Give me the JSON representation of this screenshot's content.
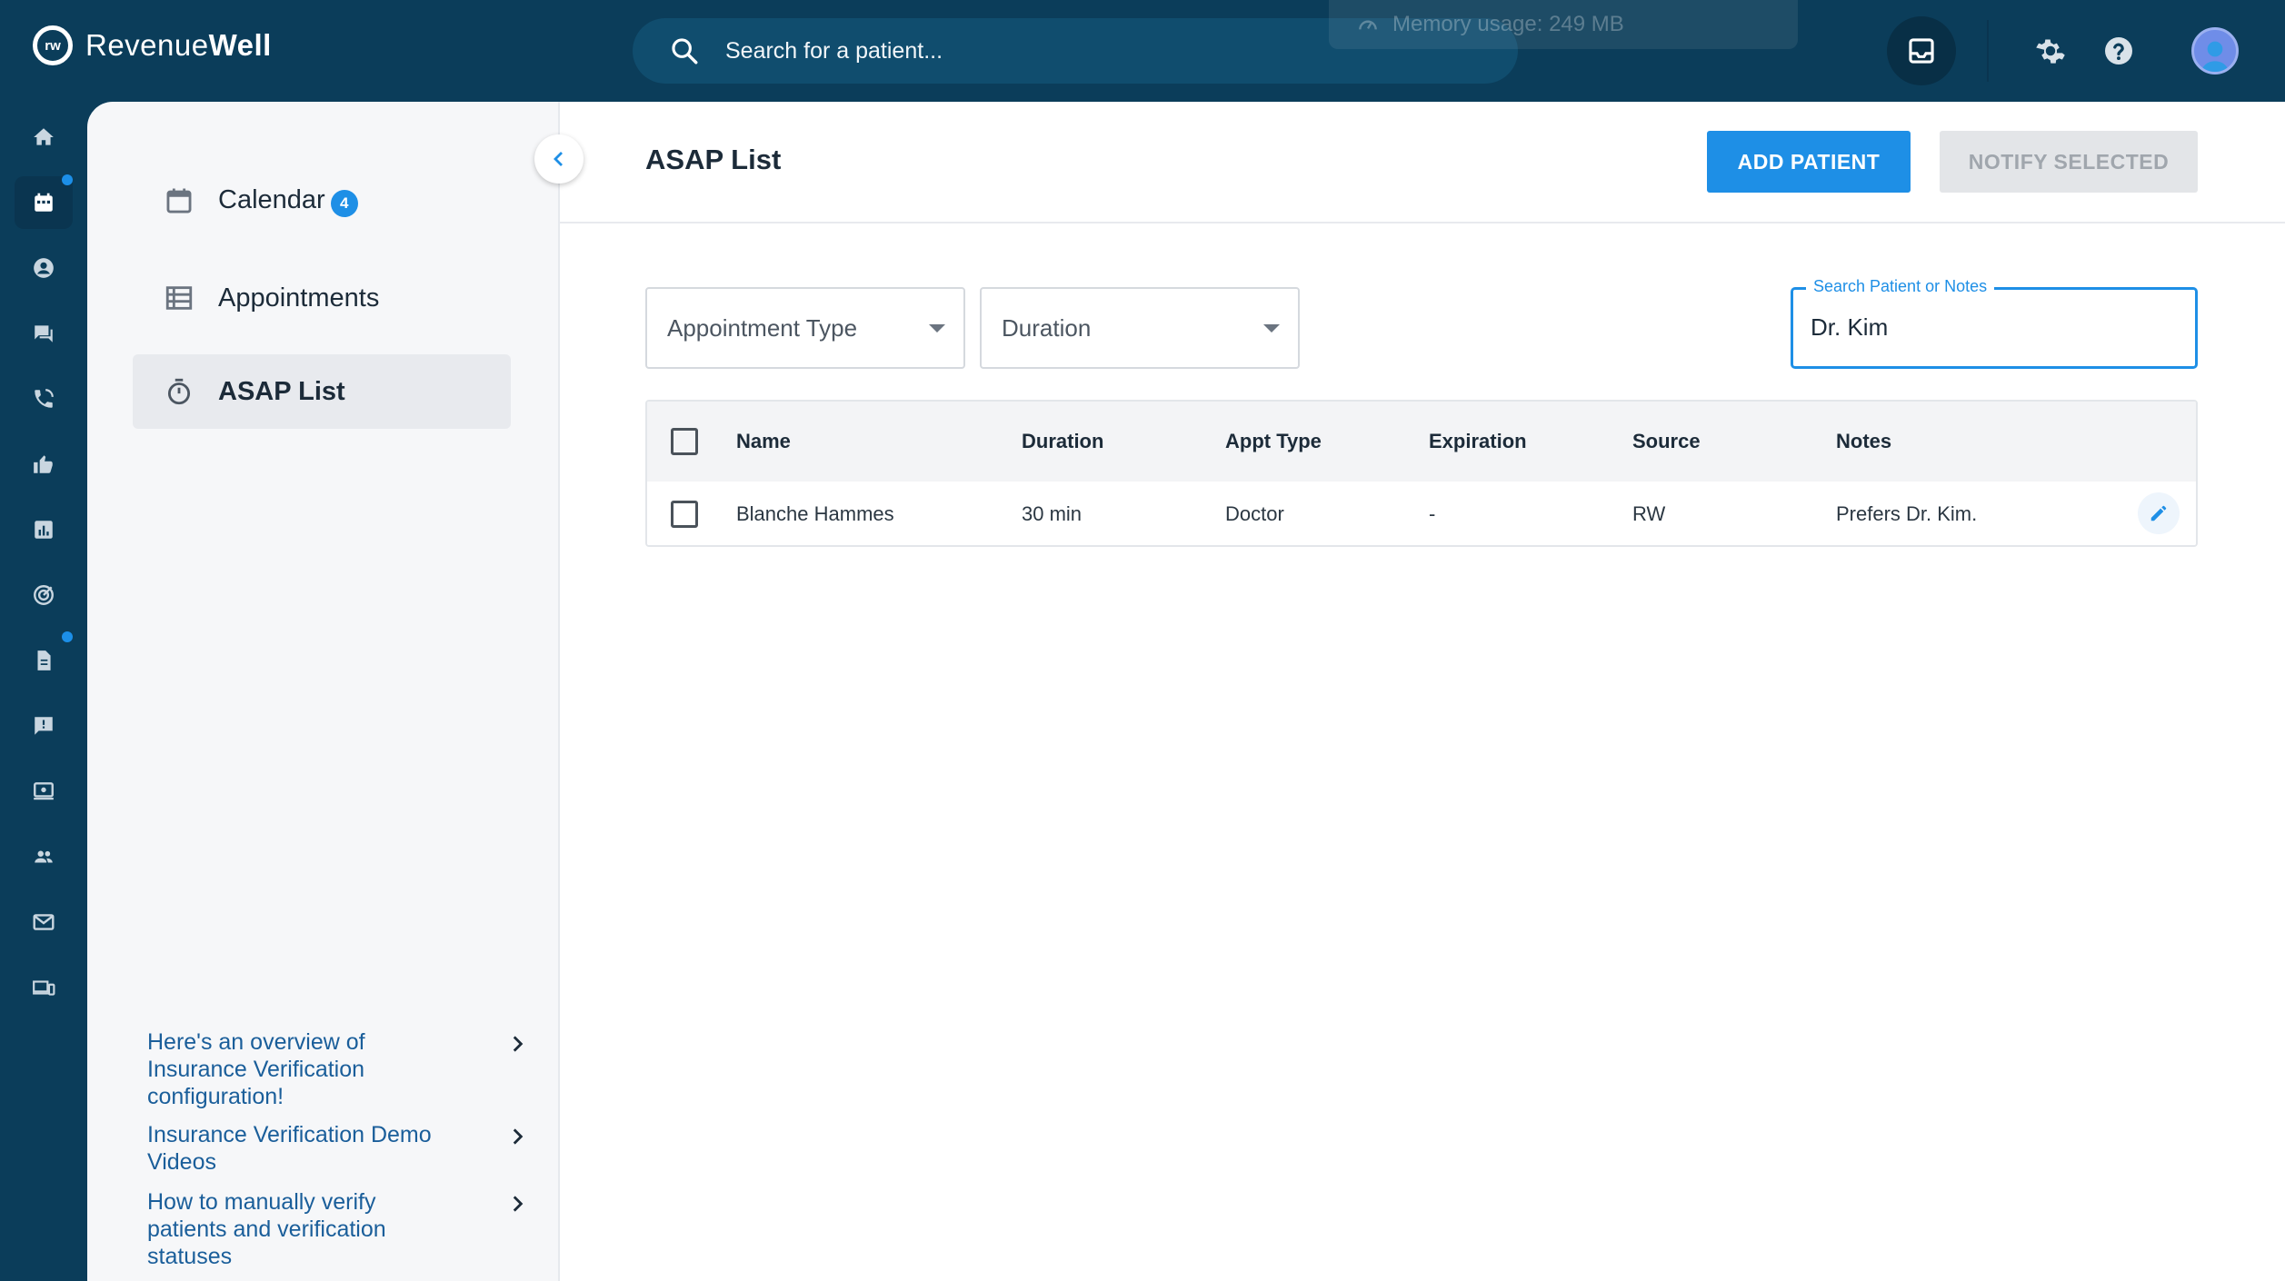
{
  "app": {
    "brand_light": "Revenue",
    "brand_bold": "Well",
    "logo_mark": "rw"
  },
  "topbar": {
    "search_placeholder": "Search for a patient...",
    "memory_text": "Memory usage: 249 MB",
    "icons": [
      "inbox-icon",
      "gear-icon",
      "help-icon",
      "avatar"
    ]
  },
  "rail": {
    "items": [
      "home-icon",
      "calendar-icon",
      "person-icon",
      "chat-icon",
      "phone-icon",
      "thumb-up-icon",
      "chart-icon",
      "target-icon",
      "document-icon",
      "feedback-icon",
      "screen-icon",
      "group-icon",
      "mail-icon",
      "devices-icon"
    ],
    "active": "calendar-icon"
  },
  "sidebar": {
    "items": [
      {
        "label": "Calendar",
        "badge": "4",
        "icon": "calendar-icon"
      },
      {
        "label": "Appointments",
        "icon": "list-icon"
      },
      {
        "label": "ASAP List",
        "icon": "timer-icon",
        "active": true
      }
    ],
    "help_links": [
      "Here's an overview of Insurance Verification configuration!",
      "Insurance Verification Demo Videos",
      "How to manually verify patients and verification statuses"
    ]
  },
  "page": {
    "title": "ASAP List",
    "add_patient": "ADD PATIENT",
    "notify_selected": "NOTIFY SELECTED"
  },
  "filters": {
    "appointment_type": "Appointment Type",
    "duration": "Duration",
    "search_label": "Search Patient or Notes",
    "search_value": "Dr. Kim"
  },
  "table": {
    "columns": [
      "Name",
      "Duration",
      "Appt Type",
      "Expiration",
      "Source",
      "Notes"
    ],
    "rows": [
      {
        "name": "Blanche Hammes",
        "duration": "30 min",
        "appt_type": "Doctor",
        "expiration": "-",
        "source": "RW",
        "notes": "Prefers Dr. Kim."
      }
    ]
  },
  "colors": {
    "primary": "#1e8fe6",
    "nav_dark": "#0b3d5a",
    "link": "#1a5e9a"
  }
}
